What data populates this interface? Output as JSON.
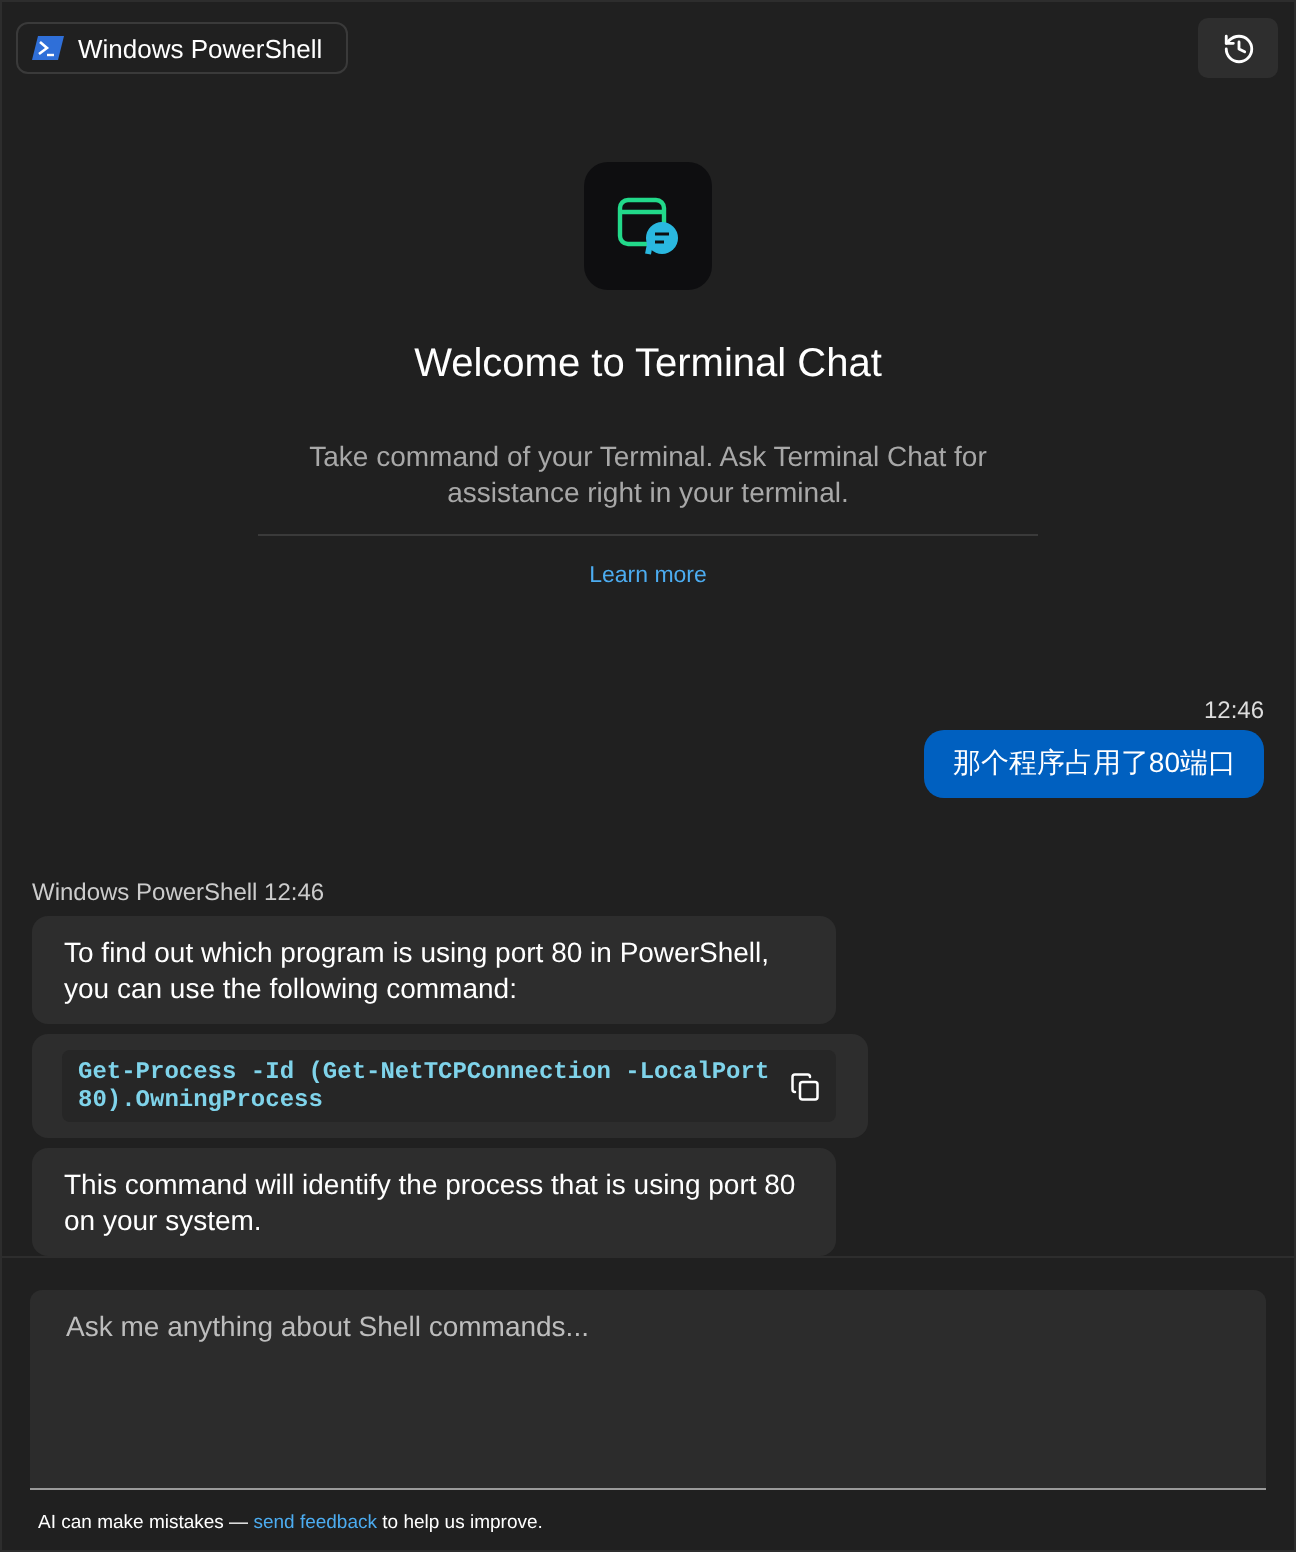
{
  "header": {
    "profile": "Windows PowerShell"
  },
  "welcome": {
    "title": "Welcome to Terminal Chat",
    "description": "Take command of your Terminal. Ask Terminal Chat for assistance right in your terminal.",
    "link": "Learn more"
  },
  "messages": [
    {
      "kind": "user",
      "time": "12:46",
      "text": "那个程序占用了80端口"
    },
    {
      "kind": "sender",
      "text": "Windows PowerShell 12:46"
    },
    {
      "kind": "assistant",
      "text": "To find out which program is using port 80 in PowerShell, you can use the following command:"
    },
    {
      "kind": "code",
      "text": "Get-Process -Id (Get-NetTCPConnection -LocalPort 80).OwningProcess"
    },
    {
      "kind": "assistant",
      "text": "This command will identify the process that is using port 80 on your system."
    }
  ],
  "input": {
    "placeholder": "Ask me anything about Shell commands..."
  },
  "footer": {
    "before": "AI can make mistakes — ",
    "link": "send feedback",
    "after": " to help us improve."
  }
}
